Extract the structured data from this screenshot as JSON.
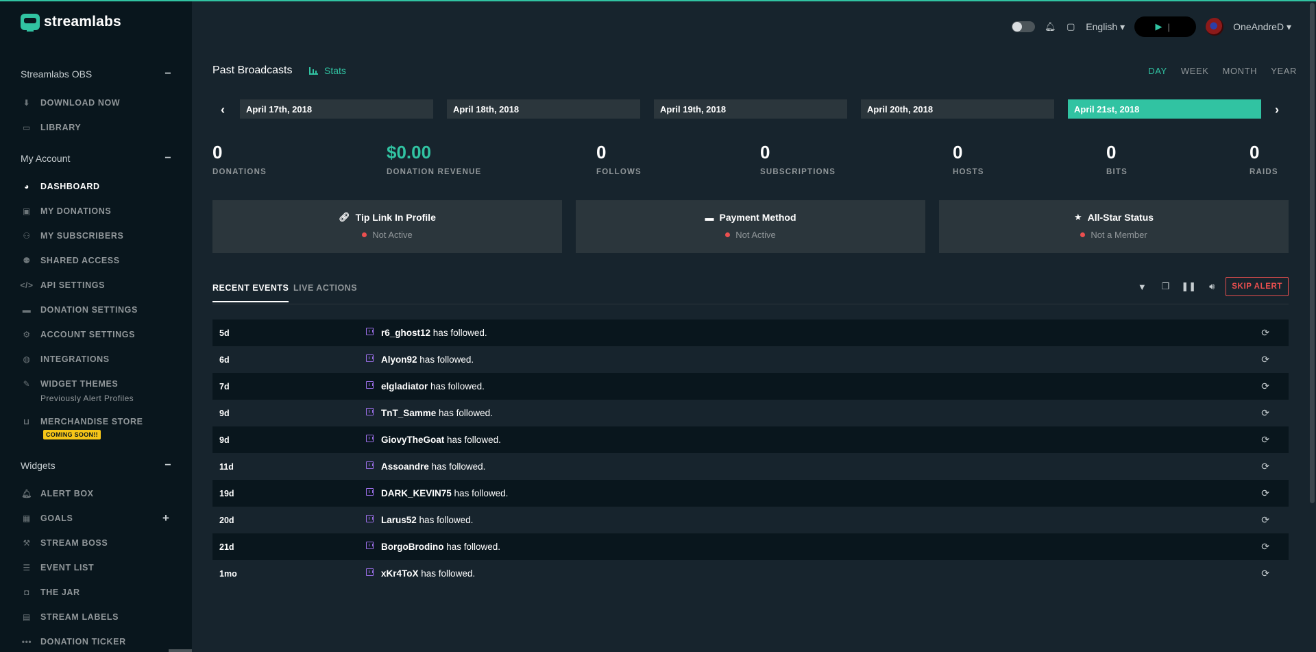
{
  "brand": {
    "name": "streamlabs"
  },
  "sidebar": {
    "sections": [
      {
        "title": "Streamlabs OBS",
        "toggle": "−"
      },
      {
        "title": "My Account",
        "toggle": "−"
      },
      {
        "title": "Widgets",
        "toggle": "−"
      }
    ],
    "items": [
      {
        "label": "DOWNLOAD NOW",
        "icon": "download-icon"
      },
      {
        "label": "LIBRARY",
        "icon": "image-icon"
      },
      {
        "label": "DASHBOARD",
        "icon": "speedometer-icon",
        "active": true
      },
      {
        "label": "MY DONATIONS",
        "icon": "gift-icon"
      },
      {
        "label": "MY SUBSCRIBERS",
        "icon": "user-plus-icon"
      },
      {
        "label": "SHARED ACCESS",
        "icon": "users-icon"
      },
      {
        "label": "API SETTINGS",
        "icon": "code-icon"
      },
      {
        "label": "DONATION SETTINGS",
        "icon": "credit-card-icon"
      },
      {
        "label": "ACCOUNT SETTINGS",
        "icon": "gear-icon"
      },
      {
        "label": "INTEGRATIONS",
        "icon": "globe-icon"
      },
      {
        "label": "WIDGET THEMES",
        "icon": "pencil-square-icon",
        "sub": "Previously Alert Profiles"
      },
      {
        "label": "MERCHANDISE STORE",
        "icon": "basket-icon",
        "badge": "COMING SOON!!"
      },
      {
        "label": "ALERT BOX",
        "icon": "bell-icon"
      },
      {
        "label": "GOALS",
        "icon": "calendar-icon",
        "plus": "+"
      },
      {
        "label": "STREAM BOSS",
        "icon": "hammer-icon"
      },
      {
        "label": "EVENT LIST",
        "icon": "list-icon"
      },
      {
        "label": "THE JAR",
        "icon": "jar-icon"
      },
      {
        "label": "STREAM LABELS",
        "icon": "document-icon"
      },
      {
        "label": "DONATION TICKER",
        "icon": "ellipsis-icon"
      }
    ]
  },
  "topbar": {
    "language": "English",
    "username": "OneAndreD"
  },
  "main": {
    "title": "Past Broadcasts",
    "stats_link": "Stats",
    "periods": [
      {
        "label": "DAY",
        "active": true
      },
      {
        "label": "WEEK"
      },
      {
        "label": "MONTH"
      },
      {
        "label": "YEAR"
      }
    ],
    "dates": [
      {
        "label": "April 17th, 2018"
      },
      {
        "label": "April 18th, 2018"
      },
      {
        "label": "April 19th, 2018"
      },
      {
        "label": "April 20th, 2018"
      },
      {
        "label": "April 21st, 2018",
        "active": true
      }
    ],
    "stats": [
      {
        "value": "0",
        "label": "DONATIONS"
      },
      {
        "value": "$0.00",
        "label": "DONATION REVENUE",
        "highlight": true
      },
      {
        "value": "0",
        "label": "FOLLOWS"
      },
      {
        "value": "0",
        "label": "SUBSCRIPTIONS"
      },
      {
        "value": "0",
        "label": "HOSTS"
      },
      {
        "value": "0",
        "label": "BITS"
      },
      {
        "value": "0",
        "label": "RAIDS"
      }
    ],
    "cards": [
      {
        "title": "Tip Link In Profile",
        "status": "Not Active",
        "icon": "link-icon"
      },
      {
        "title": "Payment Method",
        "status": "Not Active",
        "icon": "credit-card-icon"
      },
      {
        "title": "All-Star Status",
        "status": "Not a Member",
        "icon": "star-icon"
      }
    ],
    "tabs": [
      {
        "label": "RECENT EVENTS",
        "active": true
      },
      {
        "label": "LIVE ACTIONS"
      }
    ],
    "skip_alert": "SKIP ALERT",
    "events": [
      {
        "time": "5d",
        "name": "r6_ghost12",
        "action": "has followed."
      },
      {
        "time": "6d",
        "name": "Alyon92",
        "action": "has followed."
      },
      {
        "time": "7d",
        "name": "elgladiator",
        "action": "has followed."
      },
      {
        "time": "9d",
        "name": "TnT_Samme",
        "action": "has followed."
      },
      {
        "time": "9d",
        "name": "GiovyTheGoat",
        "action": "has followed."
      },
      {
        "time": "11d",
        "name": "Assoandre",
        "action": "has followed."
      },
      {
        "time": "19d",
        "name": "DARK_KEVIN75",
        "action": "has followed."
      },
      {
        "time": "20d",
        "name": "Larus52",
        "action": "has followed."
      },
      {
        "time": "21d",
        "name": "BorgoBrodino",
        "action": "has followed."
      },
      {
        "time": "1mo",
        "name": "xKr4ToX",
        "action": "has followed."
      }
    ]
  },
  "colors": {
    "accent": "#31c3a2",
    "danger": "#eb4f4f",
    "twitch": "#9b6ee8"
  }
}
